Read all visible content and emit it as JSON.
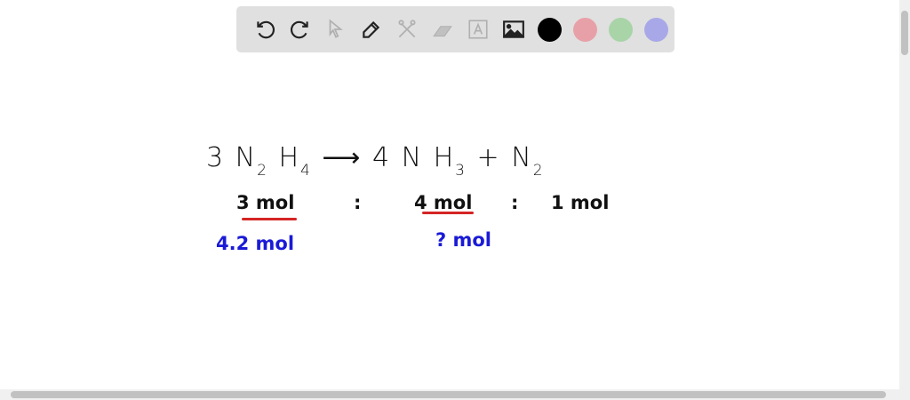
{
  "toolbar": {
    "tools": [
      {
        "icon": "undo-icon"
      },
      {
        "icon": "redo-icon"
      },
      {
        "icon": "pointer-icon"
      },
      {
        "icon": "pen-icon"
      },
      {
        "icon": "tools-icon"
      },
      {
        "icon": "eraser-icon"
      },
      {
        "icon": "text-icon",
        "label": "A"
      },
      {
        "icon": "image-icon"
      }
    ],
    "colors": [
      "#000000",
      "#e8a0a8",
      "#a8d4a8",
      "#a8a8e8"
    ]
  },
  "canvas": {
    "equation": {
      "coef1": "3",
      "r1a": "N",
      "r1a_sub": "2",
      "r1b": "H",
      "r1b_sub": "4",
      "arrow": "⟶",
      "coef2": "4",
      "p1a": "N",
      "p1b": "H",
      "p1b_sub": "3",
      "plus": "+",
      "p2": "N",
      "p2_sub": "2"
    },
    "ratio": {
      "a": "3 mol",
      "sep1": ":",
      "b": "4 mol",
      "sep2": ":",
      "c": "1 mol"
    },
    "given": {
      "a": "4.2 mol",
      "b": "? mol"
    },
    "colors": {
      "ink": "#111111",
      "underline": "#d42424",
      "blue": "#1a1ad6"
    }
  }
}
